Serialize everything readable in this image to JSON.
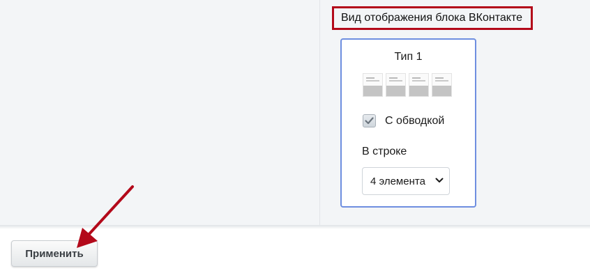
{
  "section": {
    "title": "Вид отображения блока ВКонтакте"
  },
  "card": {
    "title": "Тип 1",
    "checkbox_label": "С обводкой",
    "checkbox_checked": true,
    "row_label": "В строке",
    "select_value": "4 элемента"
  },
  "footer": {
    "apply_label": "Применить"
  },
  "colors": {
    "highlight": "#b3091a",
    "card_border": "#6e8ee0"
  },
  "icons": [
    "checkmark-icon",
    "chevron-down-icon",
    "annotation-arrow"
  ]
}
